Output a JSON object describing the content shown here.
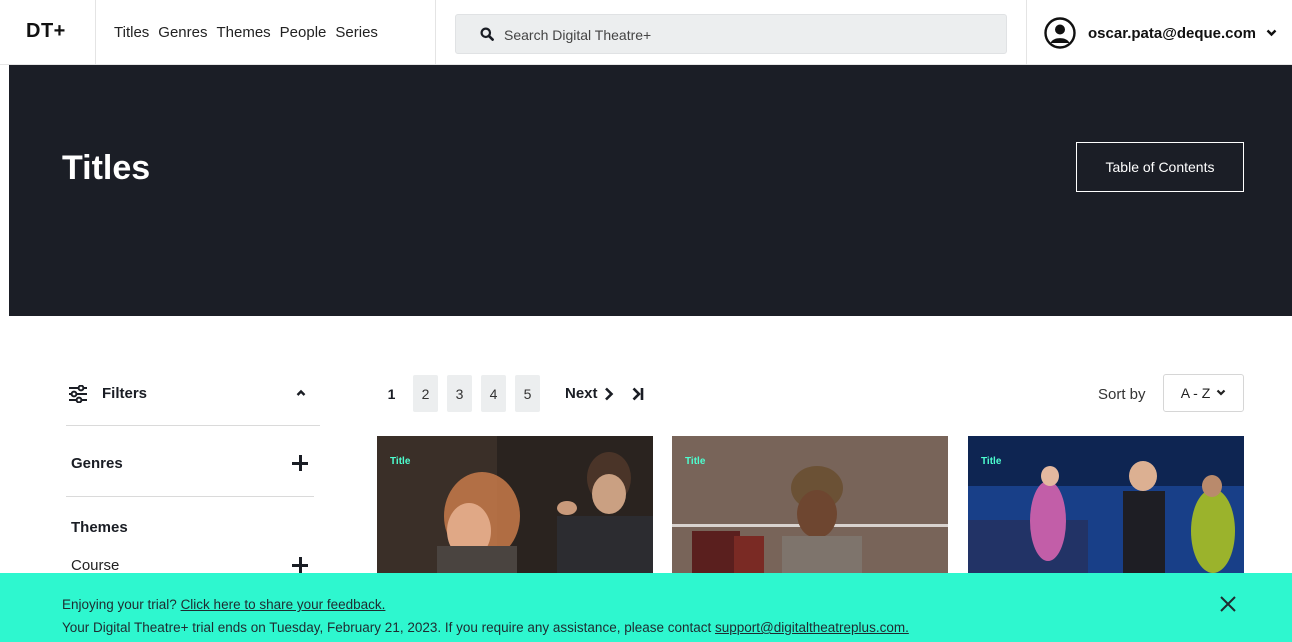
{
  "header": {
    "logo": "DT+",
    "nav": [
      "Titles",
      "Genres",
      "Themes",
      "People",
      "Series"
    ],
    "search_placeholder": "Search Digital Theatre+",
    "user_email": "oscar.pata@deque.com"
  },
  "hero": {
    "title": "Titles",
    "toc_button": "Table of Contents"
  },
  "filters": {
    "label": "Filters",
    "genres": "Genres",
    "themes": "Themes",
    "course": "Course"
  },
  "pagination": {
    "current": "1",
    "pages": [
      "2",
      "3",
      "4",
      "5"
    ],
    "next": "Next"
  },
  "sort": {
    "label": "Sort by",
    "value": "A - Z"
  },
  "cards": [
    {
      "tag": "Title"
    },
    {
      "tag": "Title"
    },
    {
      "tag": "Title"
    }
  ],
  "banner": {
    "line1_text": "Enjoying your trial? ",
    "line1_link": "Click here to share your feedback.",
    "line2_text": "Your Digital Theatre+ trial ends on Tuesday, February 21, 2023. If you require any assistance, please contact ",
    "line2_link": "support@digitaltheatreplus.com."
  },
  "colors": {
    "hero_bg": "#1b1e26",
    "accent": "#2ef7cf",
    "tag": "#4dffd0"
  }
}
